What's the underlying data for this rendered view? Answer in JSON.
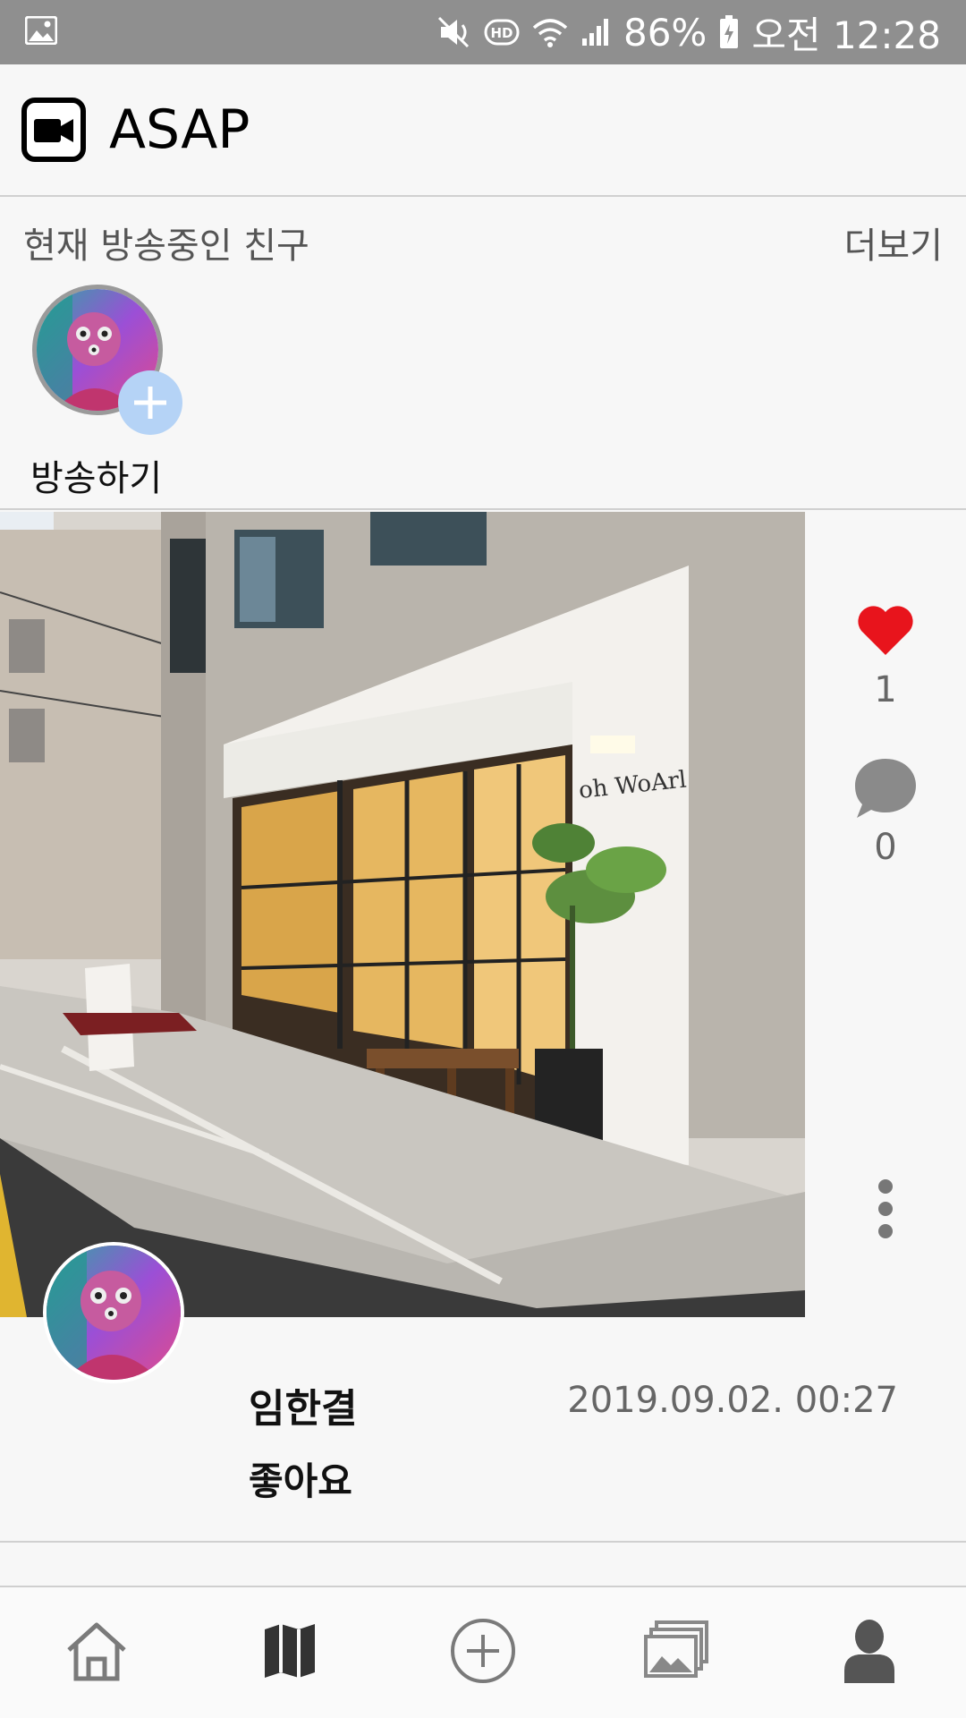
{
  "status_bar": {
    "battery": "86%",
    "time": "오전 12:28",
    "icons": [
      "image-icon",
      "mute-icon",
      "hd-icon",
      "wifi-icon",
      "signal-icon",
      "battery-charging-icon"
    ]
  },
  "header": {
    "title": "ASAP",
    "logo_icon": "video-camera-icon"
  },
  "live": {
    "title": "현재 방송중인 친구",
    "more": "더보기",
    "broadcast_label": "방송하기"
  },
  "post": {
    "likes": "1",
    "comments": "0",
    "author": "임한결",
    "date": "2019.09.02. 00:27",
    "text": "좋아요"
  },
  "nav": {
    "items": [
      "home-icon",
      "map-icon",
      "add-circle-icon",
      "gallery-icon",
      "profile-icon"
    ]
  },
  "colors": {
    "status_bar": "#8f8f8f",
    "background": "#f7f7f7",
    "heart": "#e8141c",
    "badge": "#b5d3f6"
  }
}
